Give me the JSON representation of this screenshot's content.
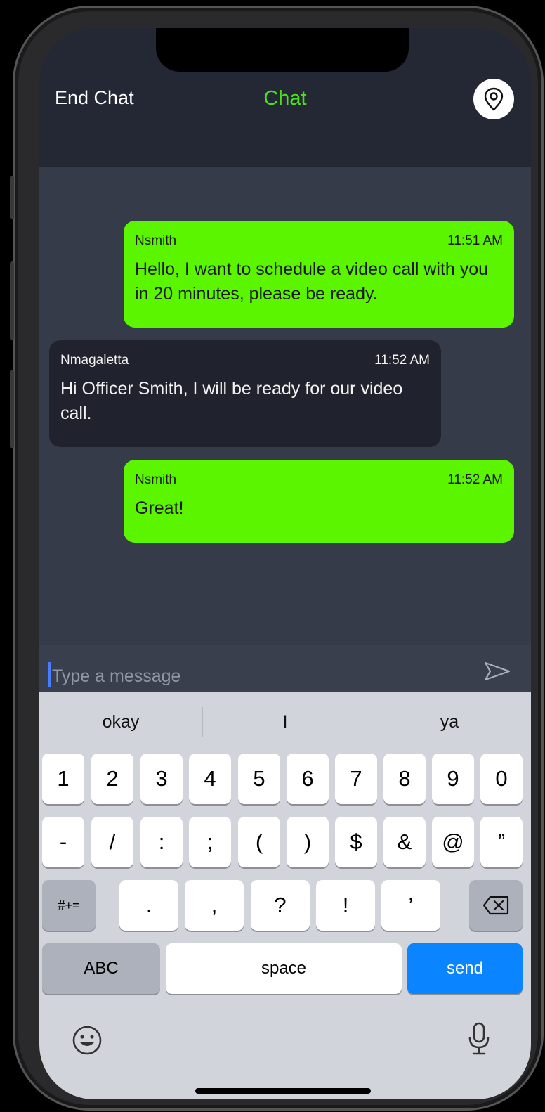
{
  "header": {
    "end_chat_label": "End Chat",
    "title": "Chat",
    "location_icon": "map-pin-icon"
  },
  "colors": {
    "accent_green": "#5cf500",
    "title_green": "#4ce01c",
    "send_blue": "#0a84ff",
    "header_bg": "#242834",
    "chat_bg": "#363b49"
  },
  "messages": [
    {
      "sender": "Nsmith",
      "time": "11:51 AM",
      "text": "Hello, I want to schedule a video call with you in 20 minutes, please be ready.",
      "direction": "outgoing"
    },
    {
      "sender": "Nmagaletta",
      "time": "11:52 AM",
      "text": "Hi Officer Smith, I will be ready for our video call.",
      "direction": "incoming"
    },
    {
      "sender": "Nsmith",
      "time": "11:52 AM",
      "text": "Great!",
      "direction": "outgoing"
    }
  ],
  "composer": {
    "placeholder": "Type a message",
    "send_icon": "send-arrow-icon"
  },
  "keyboard": {
    "suggestions": [
      "okay",
      "I",
      "ya"
    ],
    "row1": [
      "1",
      "2",
      "3",
      "4",
      "5",
      "6",
      "7",
      "8",
      "9",
      "0"
    ],
    "row2": [
      "-",
      "/",
      ":",
      ";",
      "(",
      ")",
      "$",
      "&",
      "@",
      "”"
    ],
    "row3_special": "#+=",
    "row3": [
      ".",
      ",",
      "?",
      "!",
      "’"
    ],
    "delete_icon": "backspace-icon",
    "abc": "ABC",
    "space": "space",
    "send": "send",
    "emoji_icon": "emoji-icon",
    "mic_icon": "microphone-icon"
  }
}
